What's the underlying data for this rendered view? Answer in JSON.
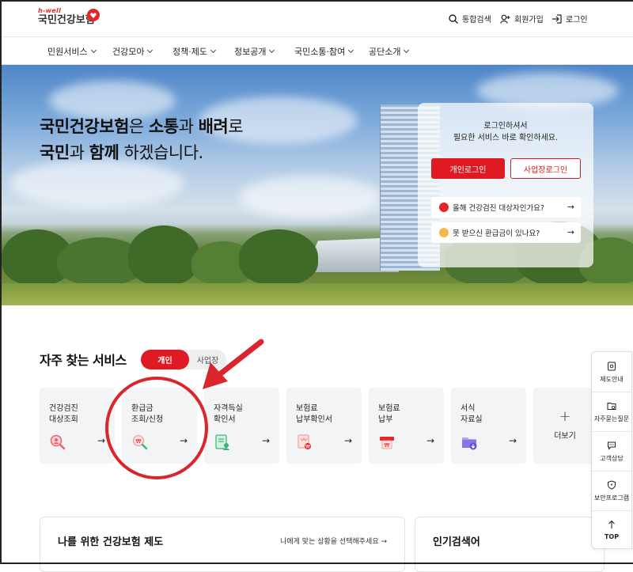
{
  "header": {
    "logo_small": "h-well",
    "logo_main": "국민건강보험",
    "top_cut": "· ··· · · ··· · ··· ·· ·· ·· ·",
    "search": "통합검색",
    "signup": "회원가입",
    "login": "로그인"
  },
  "gnb": [
    "민원서비스",
    "건강모아",
    "정책·제도",
    "정보공개",
    "국민소통·참여",
    "공단소개"
  ],
  "hero": {
    "line1_a": "국민건강보험",
    "line1_b": "은 ",
    "line1_c": "소통",
    "line1_d": "과 ",
    "line1_e": "배려",
    "line1_f": "로",
    "line2_a": "국민",
    "line2_b": "과 ",
    "line2_c": "함께",
    "line2_d": " 하겠습니다."
  },
  "login_card": {
    "msg1": "로그인하셔서",
    "msg2": "필요한 서비스 바로 확인하세요.",
    "personal_login": "개인로그인",
    "business_login": "사업장로그인",
    "link1": "올해 건강검진 대상자인가요?",
    "link2": "못 받으신 환급금이 있나요?",
    "arrow": "→"
  },
  "services": {
    "title": "자주 찾는 서비스",
    "toggle_on": "개인",
    "toggle_off": "사업장",
    "items": [
      {
        "label": "건강검진\n대상조회",
        "icon": "search-person-icon"
      },
      {
        "label": "환급금\n조회/신청",
        "icon": "refund-search-icon"
      },
      {
        "label": "자격득실\n확인서",
        "icon": "certificate-icon"
      },
      {
        "label": "보험료\n납부확인서",
        "icon": "payment-document-icon"
      },
      {
        "label": "보험료\n납부",
        "icon": "payment-card-icon"
      },
      {
        "label": "서식\n자료실",
        "icon": "folder-download-icon"
      }
    ],
    "more_plus": "+",
    "more_label": "더보기",
    "arrow": "→"
  },
  "panels": {
    "left_title": "나를 위한 건강보험 제도",
    "left_link": "나에게 맞는 상황을 선택해주세요 →",
    "right_title": "인기검색어"
  },
  "quick_menu": [
    "제도안내",
    "자주묻는질문",
    "고객상담",
    "보안프로그램",
    "TOP"
  ],
  "colors": {
    "brand_red": "#e01a22",
    "annotation_red": "#d9252b"
  }
}
